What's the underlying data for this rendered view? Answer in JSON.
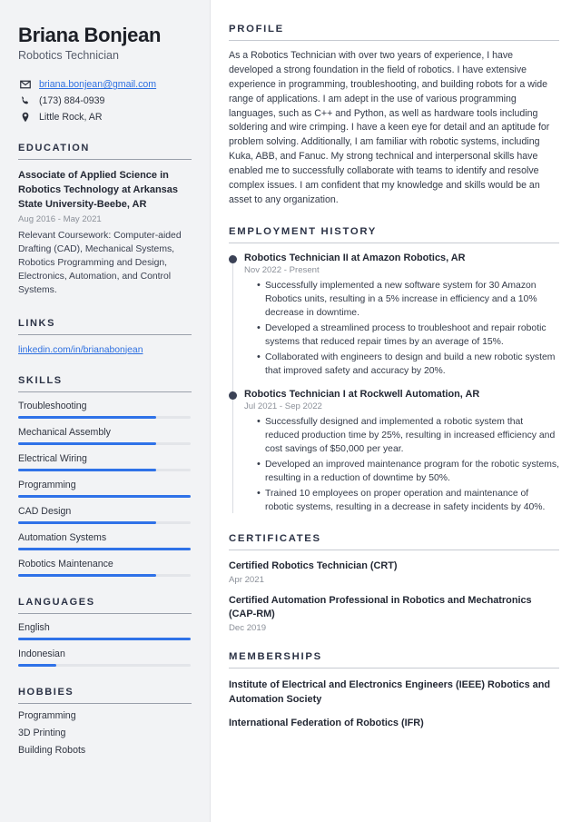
{
  "sidebar": {
    "name": "Briana Bonjean",
    "job_title": "Robotics Technician",
    "contacts": [
      {
        "icon": "envelope-icon",
        "text": "briana.bonjean@gmail.com",
        "is_link": true
      },
      {
        "icon": "phone-icon",
        "text": "(173) 884-0939",
        "is_link": false
      },
      {
        "icon": "location-pin-icon",
        "text": "Little Rock, AR",
        "is_link": false
      }
    ],
    "education": {
      "heading": "EDUCATION",
      "degree": "Associate of Applied Science in Robotics Technology at Arkansas State University-Beebe, AR",
      "date": "Aug 2016 - May 2021",
      "description": "Relevant Coursework: Computer-aided Drafting (CAD), Mechanical Systems, Robotics Programming and Design, Electronics, Automation, and Control Systems."
    },
    "links": {
      "heading": "LINKS",
      "items": [
        {
          "label": "linkedin.com/in/brianabonjean"
        }
      ]
    },
    "skills": {
      "heading": "SKILLS",
      "items": [
        {
          "label": "Troubleshooting",
          "level": 80
        },
        {
          "label": "Mechanical Assembly",
          "level": 80
        },
        {
          "label": "Electrical Wiring",
          "level": 80
        },
        {
          "label": "Programming",
          "level": 100
        },
        {
          "label": "CAD Design",
          "level": 80
        },
        {
          "label": "Automation Systems",
          "level": 100
        },
        {
          "label": "Robotics Maintenance",
          "level": 80
        }
      ]
    },
    "languages": {
      "heading": "LANGUAGES",
      "items": [
        {
          "label": "English",
          "level": 100
        },
        {
          "label": "Indonesian",
          "level": 22
        }
      ]
    },
    "hobbies": {
      "heading": "HOBBIES",
      "items": [
        {
          "label": "Programming"
        },
        {
          "label": "3D Printing"
        },
        {
          "label": "Building Robots"
        }
      ]
    }
  },
  "main": {
    "profile": {
      "heading": "PROFILE",
      "text": "As a Robotics Technician with over two years of experience, I have developed a strong foundation in the field of robotics. I have extensive experience in programming, troubleshooting, and building robots for a wide range of applications. I am adept in the use of various programming languages, such as C++ and Python, as well as hardware tools including soldering and wire crimping. I have a keen eye for detail and an aptitude for problem solving. Additionally, I am familiar with robotic systems, including Kuka, ABB, and Fanuc. My strong technical and interpersonal skills have enabled me to successfully collaborate with teams to identify and resolve complex issues. I am confident that my knowledge and skills would be an asset to any organization."
    },
    "employment": {
      "heading": "EMPLOYMENT HISTORY",
      "jobs": [
        {
          "role": "Robotics Technician II at Amazon Robotics, AR",
          "date": "Nov 2022 - Present",
          "bullets": [
            "Successfully implemented a new software system for 30 Amazon Robotics units, resulting in a 5% increase in efficiency and a 10% decrease in downtime.",
            "Developed a streamlined process to troubleshoot and repair robotic systems that reduced repair times by an average of 15%.",
            "Collaborated with engineers to design and build a new robotic system that improved safety and accuracy by 20%."
          ]
        },
        {
          "role": "Robotics Technician I at Rockwell Automation, AR",
          "date": "Jul 2021 - Sep 2022",
          "bullets": [
            "Successfully designed and implemented a robotic system that reduced production time by 25%, resulting in increased efficiency and cost savings of $50,000 per year.",
            "Developed an improved maintenance program for the robotic systems, resulting in a reduction of downtime by 50%.",
            "Trained 10 employees on proper operation and maintenance of robotic systems, resulting in a decrease in safety incidents by 40%."
          ]
        }
      ]
    },
    "certificates": {
      "heading": "CERTIFICATES",
      "items": [
        {
          "title": "Certified Robotics Technician (CRT)",
          "date": "Apr 2021"
        },
        {
          "title": "Certified Automation Professional in Robotics and Mechatronics (CAP-RM)",
          "date": "Dec 2019"
        }
      ]
    },
    "memberships": {
      "heading": "MEMBERSHIPS",
      "items": [
        {
          "title": "Institute of Electrical and Electronics Engineers (IEEE) Robotics and Automation Society"
        },
        {
          "title": "International Federation of Robotics (IFR)"
        }
      ]
    }
  },
  "theme": {
    "accent_blue": "#2f72e8",
    "heading_navy": "#2b3245",
    "sidebar_bg": "#f2f3f5",
    "link_blue": "#2d6fe0"
  }
}
